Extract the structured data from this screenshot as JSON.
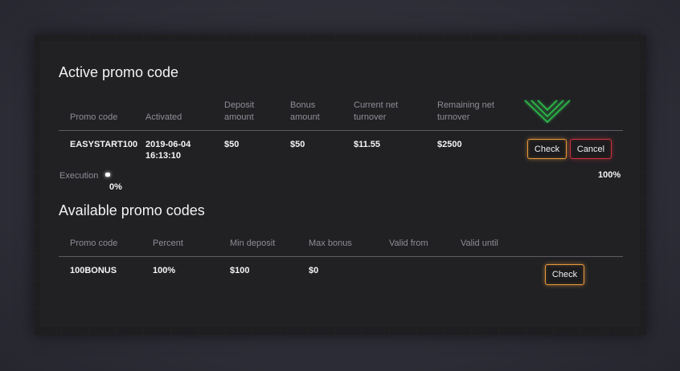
{
  "active": {
    "title": "Active promo code",
    "headers": {
      "promo_code": "Promo code",
      "activated": "Activated",
      "deposit_l1": "Deposit",
      "deposit_l2": "amount",
      "bonus_l1": "Bonus",
      "bonus_l2": "amount",
      "turnover_l1": "Current net",
      "turnover_l2": "turnover",
      "remaining_l1": "Remaining net",
      "remaining_l2": "turnover"
    },
    "row": {
      "promo_code": "EASYSTART100",
      "activated_date": "2019-06-04",
      "activated_time": "16:13:10",
      "deposit": "$50",
      "bonus": "$50",
      "turnover": "$11.55",
      "remaining": "$2500"
    },
    "buttons": {
      "check": "Check",
      "cancel": "Cancel"
    },
    "execution": {
      "label": "Execution",
      "progress": 0.0,
      "current_label": "0%",
      "max_label": "100%"
    }
  },
  "available": {
    "title": "Available promo codes",
    "headers": {
      "promo_code": "Promo code",
      "percent": "Percent",
      "min_deposit": "Min deposit",
      "max_bonus": "Max bonus",
      "valid_from": "Valid from",
      "valid_until": "Valid until"
    },
    "rows": [
      {
        "promo_code": "100BONUS",
        "percent": "100%",
        "min_deposit": "$100",
        "max_bonus": "$0",
        "valid_from": "",
        "valid_until": "",
        "button": "Check"
      }
    ]
  },
  "colors": {
    "check_border": "#e89a3c",
    "cancel_border": "#c9333c",
    "arrow": "#2fb84a"
  },
  "icons": {
    "pointer": "chevron-down-icon"
  }
}
